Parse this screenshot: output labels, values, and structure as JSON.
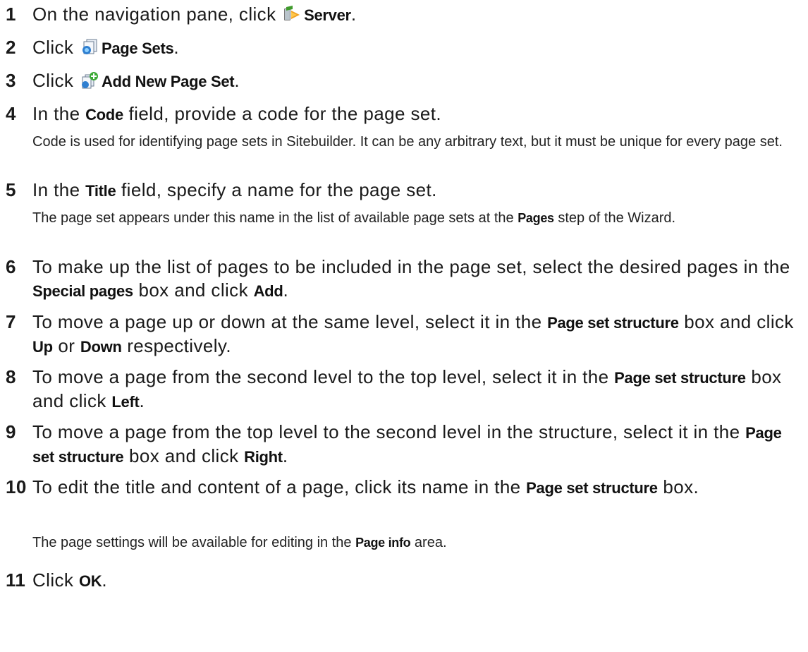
{
  "steps": [
    {
      "n": "1",
      "a": "On the navigation pane, click ",
      "icon": "server-icon",
      "b": "Server",
      "c": "."
    },
    {
      "n": "2",
      "a": "Click ",
      "icon": "page-sets-icon",
      "b": "Page Sets",
      "c": "."
    },
    {
      "n": "3",
      "a": "Click ",
      "icon": "add-page-set-icon",
      "b": "Add New Page Set",
      "c": "."
    },
    {
      "n": "4",
      "a": "In the ",
      "b": "Code",
      "c": " field, provide a code for the page set."
    },
    {
      "n": "5",
      "a": "In the ",
      "b": "Title",
      "c": " field, specify a name for the page set."
    },
    {
      "n": "6",
      "a": "To make up the list of pages to be included in the page set, select the desired pages in the ",
      "b": "Special pages",
      "c": " box and click ",
      "d": "Add",
      "e": "."
    },
    {
      "n": "7",
      "a": "To move a page up or down at the same level, select it in the ",
      "b": "Page set structure",
      "c": " box and click ",
      "d": "Up",
      "e": " or ",
      "f": "Down",
      "g": " respectively."
    },
    {
      "n": "8",
      "a": "To move a page from the second level to the top level, select it in the ",
      "b": "Page set structure",
      "c": " box and click ",
      "d": "Left",
      "e": "."
    },
    {
      "n": "9",
      "a": "To move a page from the top level to the second level in the structure, select it in the ",
      "b": "Page set structure",
      "c": " box and click ",
      "d": "Right",
      "e": "."
    },
    {
      "n": "10",
      "a": "To edit the title and content of a page, click its name in the ",
      "b": "Page set structure",
      "c": " box."
    },
    {
      "n": "11",
      "a": "Click ",
      "b": "OK",
      "c": "."
    }
  ],
  "notes": {
    "code": {
      "a": "Code is used for identifying page sets in Sitebuilder. It can be any arbitrary text, but it must be unique for every page set."
    },
    "title": {
      "a": "The page set appears under this name in the list of available page sets at the ",
      "b": "Pages",
      "c": " step of the Wizard."
    },
    "page_info": {
      "a": "The page settings will be available for editing in the ",
      "b": "Page info",
      "c": " area."
    }
  }
}
